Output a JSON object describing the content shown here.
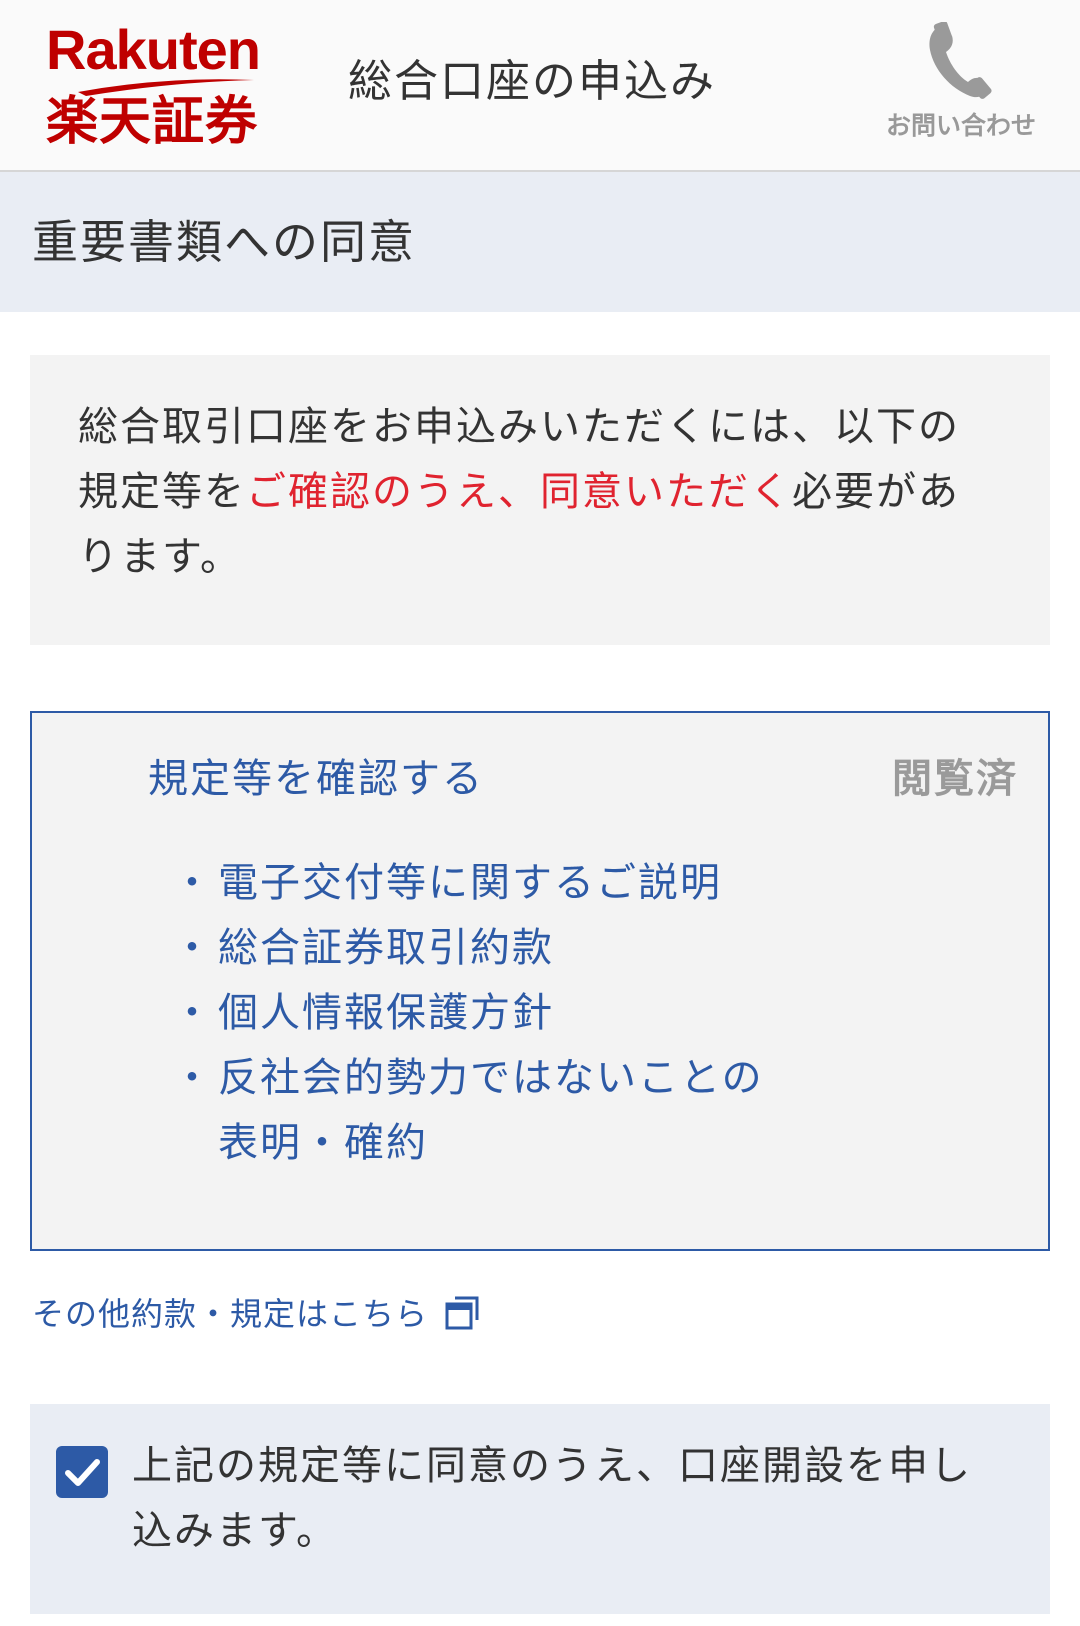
{
  "header": {
    "logo_wordmark": "Rakuten",
    "logo_kanji": "楽天証券",
    "title": "総合口座の申込み",
    "contact_label": "お問い合わせ",
    "contact_icon": "phone-icon",
    "brand_color": "#bf0000"
  },
  "section": {
    "title": "重要書類への同意"
  },
  "notice": {
    "text_1": "総合取引口座をお申込みいただくには、以下の規定等を",
    "emphasis_1": "ご確認のうえ、",
    "emphasis_2": "同意いただく",
    "text_2": "必要があります。",
    "emphasis_color": "#e0232f"
  },
  "documents": {
    "link_label": "規定等を確認する",
    "status": "閲覧済",
    "bullet": "・",
    "items": [
      "電子交付等に関するご説明",
      "総合証券取引約款",
      "個人情報保護方針",
      "反社会的勢力ではないことの表明・確約"
    ],
    "accent_color": "#2d5aa6"
  },
  "other_link": {
    "label": "その他約款・規定はこちら",
    "icon": "external-window-icon"
  },
  "agreement": {
    "checked": true,
    "label": "上記の規定等に同意のうえ、口座開設を申し込みます。",
    "icon": "checkmark-icon"
  }
}
